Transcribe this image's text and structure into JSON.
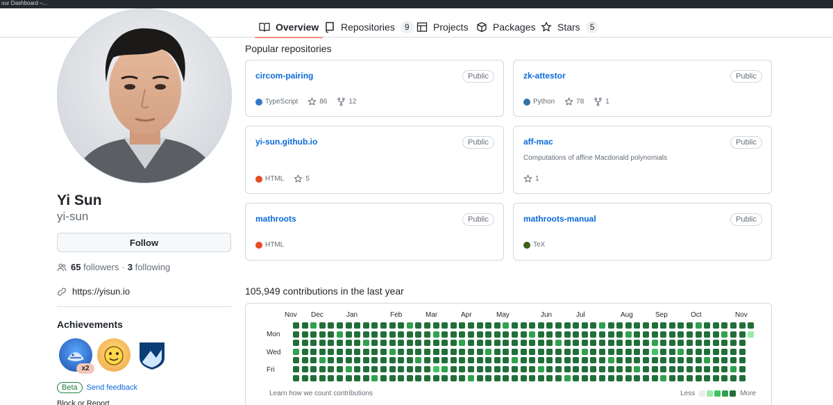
{
  "browser": {
    "tab_title": "our Dashboard –..."
  },
  "nav": {
    "tabs": [
      {
        "label": "Overview",
        "count": ""
      },
      {
        "label": "Repositories",
        "count": "9"
      },
      {
        "label": "Projects",
        "count": ""
      },
      {
        "label": "Packages",
        "count": ""
      },
      {
        "label": "Stars",
        "count": "5"
      }
    ]
  },
  "profile": {
    "name": "Yi Sun",
    "login": "yi-sun",
    "follow_label": "Follow",
    "followers_count": "65",
    "followers_label": "followers",
    "separator": "·",
    "following_count": "3",
    "following_label": "following",
    "website": "https://yisun.io"
  },
  "achievements": {
    "title": "Achievements",
    "badges": [
      "pull-shark-badge",
      "quickdraw-badge",
      "arctic-code-vault-badge"
    ],
    "multiplier": "x2",
    "beta_label": "Beta",
    "feedback_label": "Send feedback",
    "block_label": "Block or Report"
  },
  "popular": {
    "title": "Popular repositories",
    "repos": [
      {
        "name": "circom-pairing",
        "visibility": "Public",
        "description": "",
        "language": "TypeScript",
        "language_color": "#3178c6",
        "stars": "86",
        "forks": "12"
      },
      {
        "name": "zk-attestor",
        "visibility": "Public",
        "description": "",
        "language": "Python",
        "language_color": "#3572A5",
        "stars": "78",
        "forks": "1"
      },
      {
        "name": "yi-sun.github.io",
        "visibility": "Public",
        "description": "",
        "language": "HTML",
        "language_color": "#e34c26",
        "stars": "5",
        "forks": ""
      },
      {
        "name": "aff-mac",
        "visibility": "Public",
        "description": "Computations of affine Macdonald polynomials",
        "language": "",
        "language_color": "",
        "stars": "1",
        "forks": ""
      },
      {
        "name": "mathroots",
        "visibility": "Public",
        "description": "",
        "language": "HTML",
        "language_color": "#e34c26",
        "stars": "",
        "forks": ""
      },
      {
        "name": "mathroots-manual",
        "visibility": "Public",
        "description": "",
        "language": "TeX",
        "language_color": "#3D6117",
        "stars": "",
        "forks": ""
      }
    ]
  },
  "contributions": {
    "title": "105,949 contributions in the last year",
    "months": [
      "Nov",
      "Dec",
      "Jan",
      "Feb",
      "Mar",
      "Apr",
      "May",
      "Jun",
      "Jul",
      "Aug",
      "Sep",
      "Oct",
      "Nov"
    ],
    "days": [
      "Mon",
      "Wed",
      "Fri"
    ],
    "learn_label": "Learn how we count contributions",
    "less_label": "Less",
    "more_label": "More",
    "levels": [
      "#ebedf0",
      "#9be9a8",
      "#40c463",
      "#30a14e",
      "#216e39"
    ]
  }
}
